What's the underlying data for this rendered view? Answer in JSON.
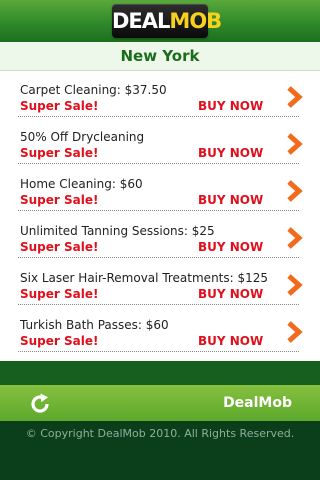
{
  "header": {
    "logo_text_a": "DEAL",
    "logo_text_b": "MOB"
  },
  "city": "New York",
  "deals": [
    {
      "title": "Carpet Cleaning: $37.50",
      "sale": "Super Sale!",
      "cta": "BUY NOW"
    },
    {
      "title": "50% Off Drycleaning",
      "sale": "Super Sale!",
      "cta": "BUY NOW"
    },
    {
      "title": "Home Cleaning: $60",
      "sale": "Super Sale!",
      "cta": "BUY NOW"
    },
    {
      "title": "Unlimited Tanning Sessions: $25",
      "sale": "Super Sale!",
      "cta": "BUY NOW"
    },
    {
      "title": "Six Laser Hair-Removal Treatments: $125",
      "sale": "Super Sale!",
      "cta": "BUY NOW"
    },
    {
      "title": "Turkish Bath Passes: $60",
      "sale": "Super Sale!",
      "cta": "BUY NOW"
    }
  ],
  "footer": {
    "brand": "DealMob",
    "copyright": "© Copyright DealMob 2010. All Rights Reserved.",
    "refresh_icon": "refresh-icon"
  },
  "colors": {
    "header_green": "#2f8a2b",
    "accent_red": "#e0101c",
    "arrow_orange": "#f26b1d",
    "footer_green": "#175f1f"
  }
}
